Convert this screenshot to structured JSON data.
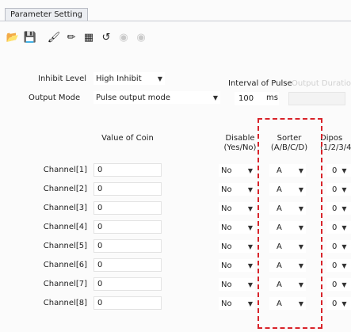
{
  "window": {
    "tab_label": "Parameter Setting"
  },
  "toolbar": {
    "buttons": [
      {
        "icon": "folder-open-icon",
        "glyph": "📂",
        "enabled": true
      },
      {
        "icon": "save-icon",
        "glyph": "💾",
        "enabled": true
      },
      {
        "icon": "paint-icon",
        "glyph": "🖌",
        "enabled": true
      },
      {
        "icon": "pencil-icon",
        "glyph": "✏",
        "enabled": true
      },
      {
        "icon": "grid-icon",
        "glyph": "▦",
        "enabled": true
      },
      {
        "icon": "reset-icon",
        "glyph": "↺",
        "enabled": true
      },
      {
        "icon": "disabled-tool-icon-1",
        "glyph": "◉",
        "enabled": false
      },
      {
        "icon": "disabled-tool-icon-2",
        "glyph": "◉",
        "enabled": false
      }
    ]
  },
  "settings": {
    "inhibit_level_label": "Inhibit Level",
    "inhibit_level_value": "High Inhibit",
    "output_mode_label": "Output Mode",
    "output_mode_value": "Pulse output mode",
    "interval_label": "Interval of Pulse",
    "interval_value": "100",
    "interval_unit": "ms",
    "disabled_label": "Output Duration"
  },
  "table": {
    "headers": {
      "value_of_coin": "Value of Coin",
      "disable_line1": "Disable",
      "disable_line2": "(Yes/No)",
      "sorter_line1": "Sorter",
      "sorter_line2": "(A/B/C/D)",
      "dip_line1": "Dipos",
      "dip_line2": "(1/2/3/4"
    },
    "rows": [
      {
        "channel": "Channel[1]",
        "coin": "0",
        "disable": "No",
        "sorter": "A",
        "dip": "0"
      },
      {
        "channel": "Channel[2]",
        "coin": "0",
        "disable": "No",
        "sorter": "A",
        "dip": "0"
      },
      {
        "channel": "Channel[3]",
        "coin": "0",
        "disable": "No",
        "sorter": "A",
        "dip": "0"
      },
      {
        "channel": "Channel[4]",
        "coin": "0",
        "disable": "No",
        "sorter": "A",
        "dip": "0"
      },
      {
        "channel": "Channel[5]",
        "coin": "0",
        "disable": "No",
        "sorter": "A",
        "dip": "0"
      },
      {
        "channel": "Channel[6]",
        "coin": "0",
        "disable": "No",
        "sorter": "A",
        "dip": "0"
      },
      {
        "channel": "Channel[7]",
        "coin": "0",
        "disable": "No",
        "sorter": "A",
        "dip": "0"
      },
      {
        "channel": "Channel[8]",
        "coin": "0",
        "disable": "No",
        "sorter": "A",
        "dip": "0"
      }
    ]
  },
  "colors": {
    "highlight_border": "#d8232a"
  }
}
